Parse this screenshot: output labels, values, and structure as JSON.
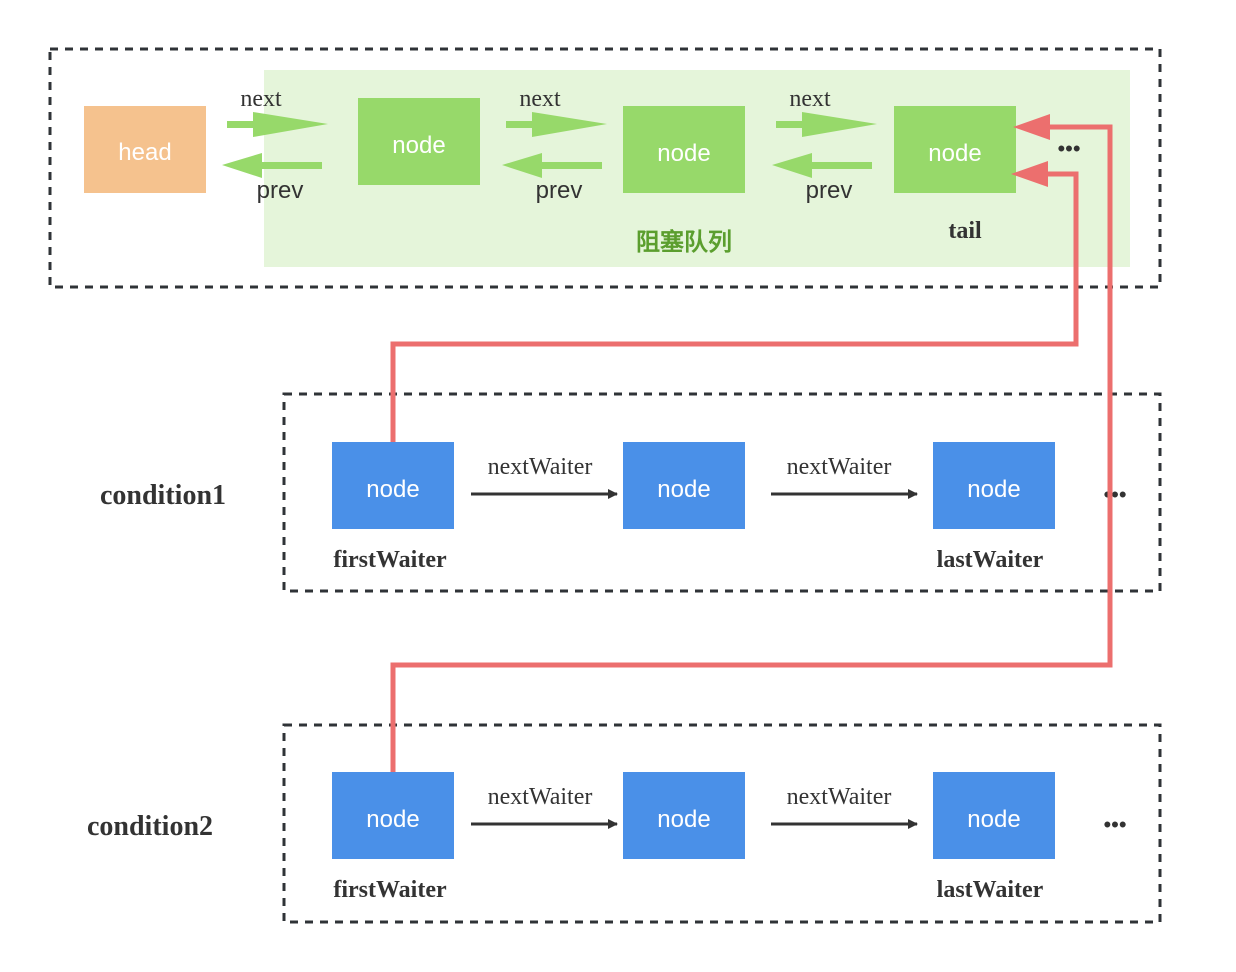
{
  "colors": {
    "head": "#f5c28e",
    "queue_node": "#97d96a",
    "queue_bg": "#e5f5da",
    "condition_node": "#4a90e8",
    "link_red": "#ec6f6e",
    "queue_label": "#5b9e2e"
  },
  "sync_queue": {
    "label": "阻塞队列",
    "head": "head",
    "nodes": [
      "node",
      "node",
      "node"
    ],
    "next_labels": [
      "next",
      "next",
      "next"
    ],
    "prev_labels": [
      "prev",
      "prev",
      "prev"
    ],
    "tail_label": "tail",
    "ellipsis": "•••"
  },
  "conditions": [
    {
      "name": "condition1",
      "nodes": [
        "node",
        "node",
        "node"
      ],
      "link_labels": [
        "nextWaiter",
        "nextWaiter"
      ],
      "first_label": "firstWaiter",
      "last_label": "lastWaiter",
      "ellipsis": "•••"
    },
    {
      "name": "condition2",
      "nodes": [
        "node",
        "node",
        "node"
      ],
      "link_labels": [
        "nextWaiter",
        "nextWaiter"
      ],
      "first_label": "firstWaiter",
      "last_label": "lastWaiter",
      "ellipsis": "•••"
    }
  ]
}
